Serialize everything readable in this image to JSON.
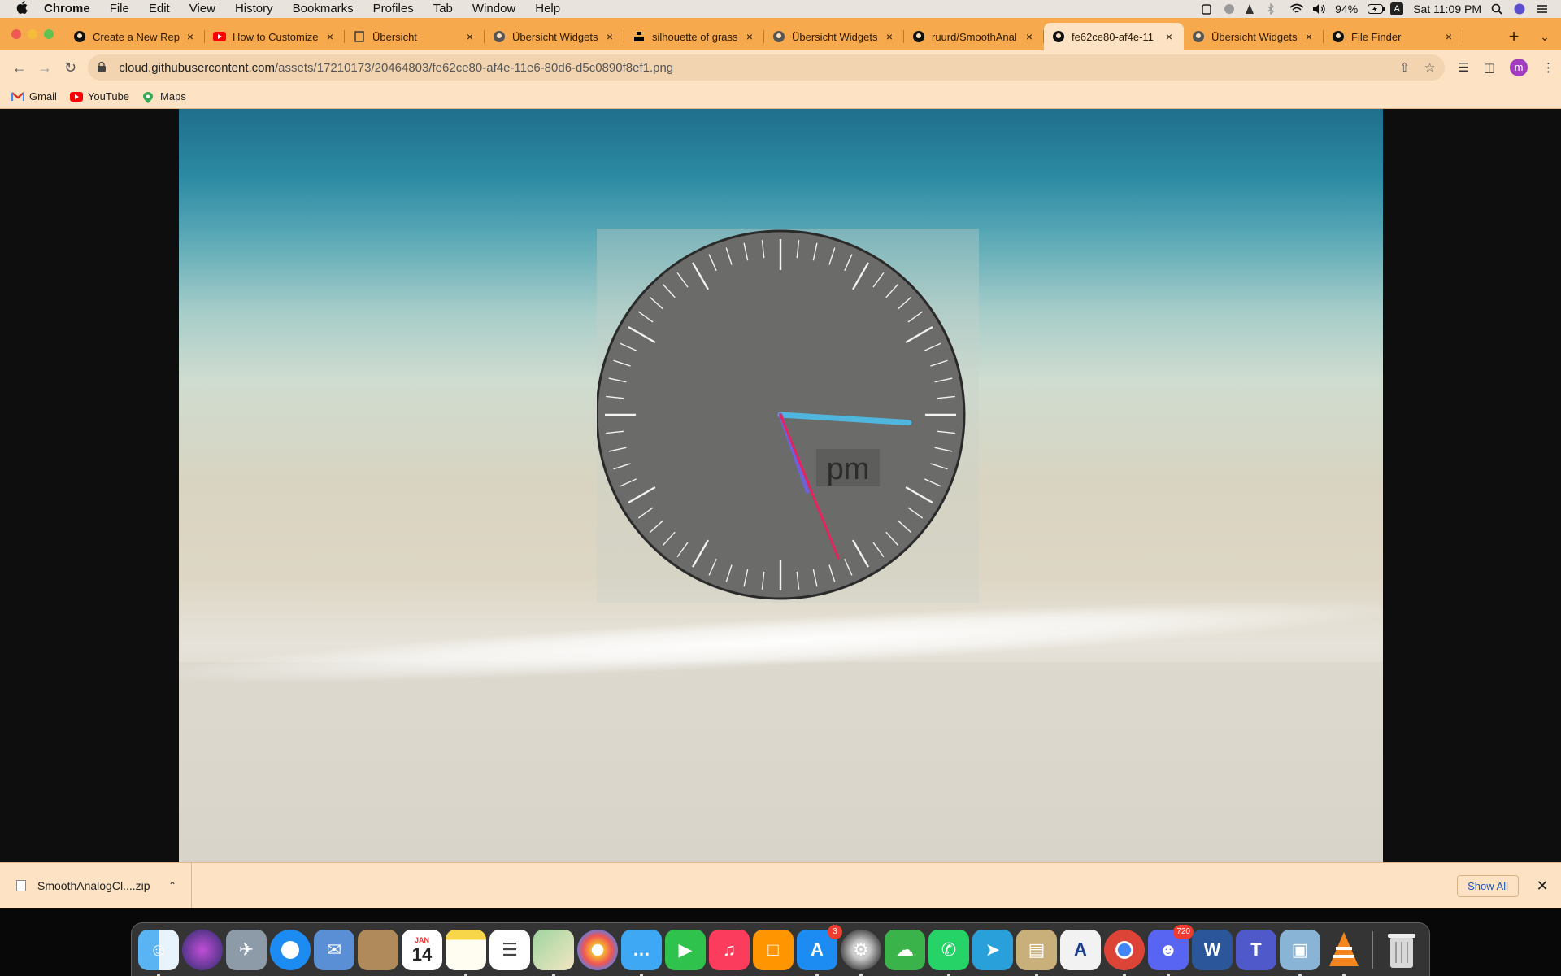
{
  "menubar": {
    "app_name": "Chrome",
    "menus": [
      "File",
      "Edit",
      "View",
      "History",
      "Bookmarks",
      "Profiles",
      "Tab",
      "Window",
      "Help"
    ],
    "battery": "94%",
    "clock": "Sat 11:09 PM",
    "input_source": "A"
  },
  "tabs": [
    {
      "title": "Create a New Repo",
      "icon": "github-icon",
      "active": false
    },
    {
      "title": "How to Customize",
      "icon": "youtube-icon",
      "active": false
    },
    {
      "title": "Übersicht",
      "icon": "page-icon",
      "active": false
    },
    {
      "title": "Übersicht Widgets",
      "icon": "globe-icon",
      "active": false
    },
    {
      "title": "silhouette of grass",
      "icon": "unsplash-icon",
      "active": false
    },
    {
      "title": "Übersicht Widgets",
      "icon": "globe-icon",
      "active": false
    },
    {
      "title": "ruurd/SmoothAnal",
      "icon": "github-icon",
      "active": false
    },
    {
      "title": "fe62ce80-af4e-11",
      "icon": "github-icon",
      "active": true
    },
    {
      "title": "Übersicht Widgets",
      "icon": "globe-icon",
      "active": false
    },
    {
      "title": "File Finder",
      "icon": "github-icon",
      "active": false
    }
  ],
  "toolbar": {
    "url_host": "cloud.githubusercontent.com",
    "url_path": "/assets/17210173/20464803/fe62ce80-af4e-11e6-80d6-d5c0890f8ef1.png",
    "avatar_letter": "m"
  },
  "bookmarks": [
    {
      "label": "Gmail",
      "icon": "gmail-icon"
    },
    {
      "label": "YouTube",
      "icon": "youtube-icon"
    },
    {
      "label": "Maps",
      "icon": "maps-icon"
    }
  ],
  "clock_widget": {
    "meridiem": "pm",
    "hours": 3,
    "minutes": 27,
    "seconds": 27,
    "hour_color": "#4fb6de",
    "minute_color": "#6c63d8",
    "second_color": "#e5245d"
  },
  "downloads": {
    "file_name": "SmoothAnalogCl....zip",
    "show_all_label": "Show All"
  },
  "dock": {
    "calendar_month": "JAN",
    "calendar_day": "14",
    "appstore_badge": "3",
    "discord_badge": "720",
    "items": [
      "finder-icon",
      "siri-icon",
      "launchpad-icon",
      "safari-icon",
      "mail-icon",
      "contacts-icon",
      "calendar-icon",
      "notes-icon",
      "reminders-icon",
      "maps-icon",
      "photos-icon",
      "messages-icon",
      "facetime-icon",
      "music-icon",
      "books-icon",
      "app-store-icon",
      "system-preferences-icon",
      "cloud-app-icon",
      "whatsapp-icon",
      "telegram-icon",
      "archive-icon",
      "font-app-icon",
      "chrome-icon",
      "discord-icon",
      "word-icon",
      "teams-icon",
      "preview-icon",
      "vlc-icon",
      "trash-icon"
    ]
  }
}
